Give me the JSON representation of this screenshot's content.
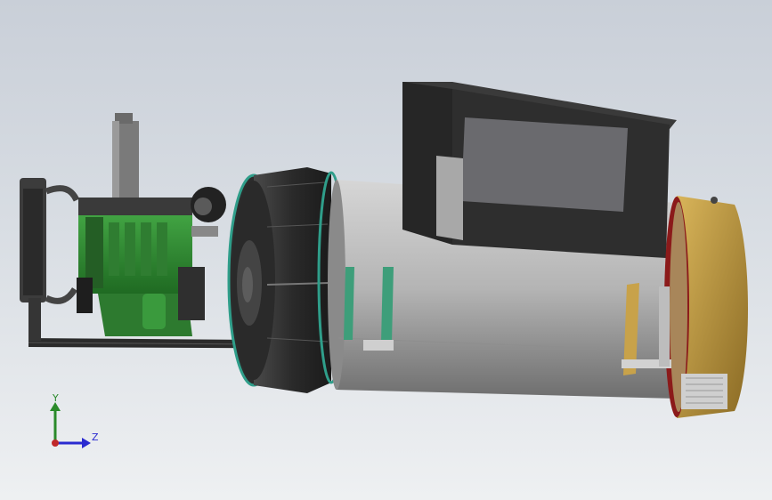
{
  "viewport": {
    "background_top": "#c9cfd8",
    "background_bottom": "#eef0f2"
  },
  "model": {
    "components": [
      {
        "name": "engine-radiator",
        "color": "#3c3c3c"
      },
      {
        "name": "diesel-engine-block",
        "color": "#2e8b2e"
      },
      {
        "name": "exhaust-muffler",
        "color": "#7a7a7a"
      },
      {
        "name": "base-frame-rail",
        "color": "#2b2b2b"
      },
      {
        "name": "flywheel-coupling-housing",
        "color": "#2f2f2f"
      },
      {
        "name": "alternator-body",
        "color": "#b8b8b8"
      },
      {
        "name": "terminal-box",
        "color": "#2c2c2c"
      },
      {
        "name": "alternator-end-cover",
        "color": "#c8a24a"
      },
      {
        "name": "mounting-brackets",
        "color": "#3e9e7a"
      }
    ]
  },
  "triad": {
    "y_label": "Y",
    "z_label": "Z",
    "y_color": "#2a8a2a",
    "z_color": "#2a2ad0",
    "origin_color": "#c0282a"
  }
}
